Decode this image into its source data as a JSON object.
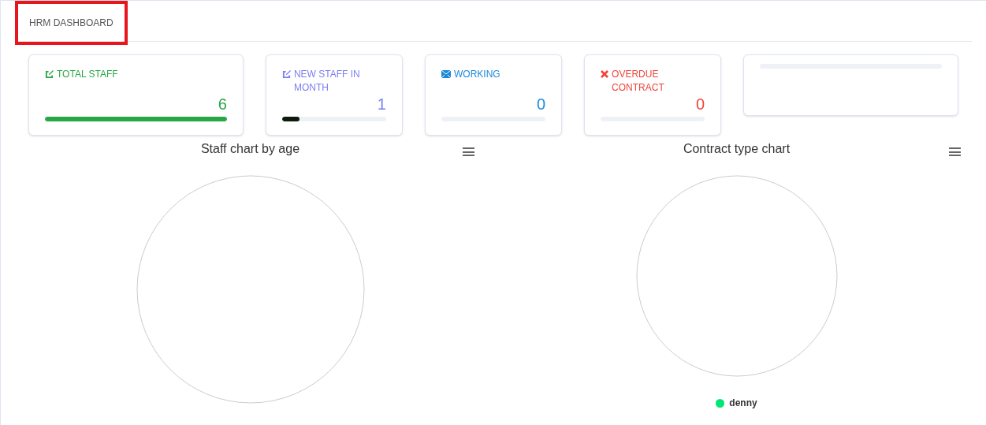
{
  "tabs": [
    {
      "label": "HRM DASHBOARD",
      "selected": true
    }
  ],
  "cards": [
    {
      "kind": "stat",
      "label": "TOTAL STAFF",
      "value": "6",
      "level": 1.0,
      "color": "#28a745"
    },
    {
      "kind": "stat",
      "label": "NEW STAFF IN MONTH",
      "value": "1",
      "level": 0.17,
      "color": "#7b7ff0"
    },
    {
      "kind": "stat",
      "label": "WORKING",
      "value": "0",
      "level": 0,
      "color": "#1e88d8"
    },
    {
      "kind": "stat",
      "label": "OVERDUE CONTRACT",
      "value": "0",
      "level": 0,
      "color": "#f0433a"
    },
    {
      "kind": "placeholder"
    }
  ],
  "charts": [
    {
      "title": "Staff chart by age"
    },
    {
      "title": "Contract type chart",
      "legend": [
        {
          "label": "denny",
          "color": "#00e676"
        }
      ]
    }
  ]
}
